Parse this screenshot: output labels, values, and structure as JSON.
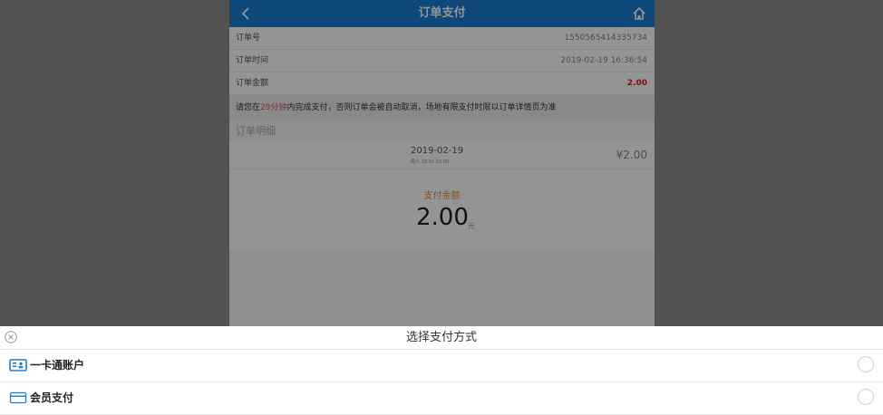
{
  "header": {
    "title": "订单支付",
    "back_icon": "chevron-left-icon",
    "home_icon": "home-icon"
  },
  "order": {
    "rows": [
      {
        "key": "订单号",
        "value": "1550565414335734"
      },
      {
        "key": "订单时间",
        "value": "2019-02-19 16:36:54"
      },
      {
        "key": "订单金额",
        "value": "2.00"
      }
    ]
  },
  "notice": {
    "pre": "请您在",
    "time": "29分钟",
    "post": "内完成支付，否则订单会被自动取消，场地有限支付时限以订单详情页为准"
  },
  "details": {
    "title": "订单明细",
    "date": "2019-02-19",
    "slot": "周六 18:01-20:00",
    "price": "¥2.00"
  },
  "payment": {
    "label": "支付金额",
    "amount": "2.00",
    "unit": "元"
  },
  "sheet": {
    "title": "选择支付方式",
    "options": [
      {
        "label": "一卡通账户",
        "icon": "id-card-icon"
      },
      {
        "label": "会员支付",
        "icon": "credit-card-icon"
      }
    ]
  },
  "colors": {
    "accent": "#1a7fd6",
    "red": "#d21e1e",
    "orange": "#e38a33"
  }
}
